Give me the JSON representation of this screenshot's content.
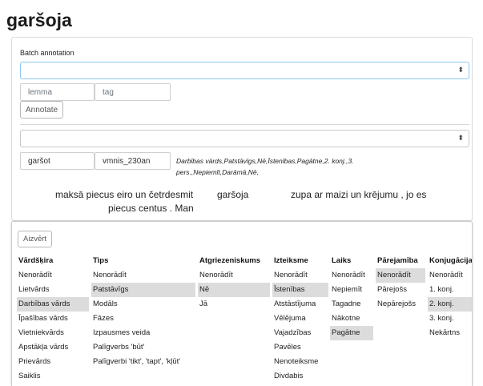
{
  "page_title": "garšoja",
  "batch": {
    "label": "Batch annotation",
    "select_caret": "⬍",
    "lemma_placeholder": "lemma",
    "tag_placeholder": "tag",
    "annotate_label": "Annotate"
  },
  "token": {
    "select_caret": "⬍",
    "lemma_value": "garšot",
    "tag_value": "vmnis_230an",
    "description": "Darbības vārds,Patstāvīgs,Nē,Īstenības,Pagātne,2. konj.,3. pers.,Nepiemīt,Darāmā,Nē,"
  },
  "sentence": {
    "line1": [
      "maksā piecus eiro un četrdesmit",
      "garšoja",
      "zupa ar maizi un krējumu , jo es"
    ],
    "line2": [
      "piecus centus . Man"
    ]
  },
  "panel": {
    "close_label": "Aizvērt",
    "columns": [
      {
        "header": "Vārdšķira",
        "items": [
          {
            "label": "Nenorādīt",
            "selected": false
          },
          {
            "label": "Lietvārds",
            "selected": false
          },
          {
            "label": "Darbības vārds",
            "selected": true
          },
          {
            "label": "Īpašības vārds",
            "selected": false
          },
          {
            "label": "Vietniekvārds",
            "selected": false
          },
          {
            "label": "Apstākļa vārds",
            "selected": false
          },
          {
            "label": "Prievārds",
            "selected": false
          },
          {
            "label": "Saiklis",
            "selected": false
          }
        ]
      },
      {
        "header": "Tips",
        "items": [
          {
            "label": "Nenorādīt",
            "selected": false
          },
          {
            "label": "Patstāvīgs",
            "selected": true
          },
          {
            "label": "Modāls",
            "selected": false
          },
          {
            "label": "Fāzes",
            "selected": false
          },
          {
            "label": "Izpausmes veida",
            "selected": false
          },
          {
            "label": "Palīgverbs 'būt'",
            "selected": false
          },
          {
            "label": "Palīgverbi 'tikt', 'tapt', 'kļūt'",
            "selected": false
          }
        ]
      },
      {
        "header": "Atgriezeniskums",
        "items": [
          {
            "label": "Nenorādīt",
            "selected": false
          },
          {
            "label": "Nē",
            "selected": true
          },
          {
            "label": "Jā",
            "selected": false
          }
        ]
      },
      {
        "header": "Izteiksme",
        "items": [
          {
            "label": "Nenorādīt",
            "selected": false
          },
          {
            "label": "Īstenības",
            "selected": true
          },
          {
            "label": "Atstāstījuma",
            "selected": false
          },
          {
            "label": "Vēlējuma",
            "selected": false
          },
          {
            "label": "Vajadzības",
            "selected": false
          },
          {
            "label": "Pavēles",
            "selected": false
          },
          {
            "label": "Nenoteiksme",
            "selected": false
          },
          {
            "label": "Divdabis",
            "selected": false
          }
        ]
      },
      {
        "header": "Laiks",
        "items": [
          {
            "label": "Nenorādīt",
            "selected": false
          },
          {
            "label": "Nepiemīt",
            "selected": false
          },
          {
            "label": "Tagadne",
            "selected": false
          },
          {
            "label": "Nākotne",
            "selected": false
          },
          {
            "label": "Pagātne",
            "selected": true
          }
        ]
      },
      {
        "header": "Pārejamība",
        "items": [
          {
            "label": "Nenorādīt",
            "selected": true
          },
          {
            "label": "Pārejošs",
            "selected": false
          },
          {
            "label": "Nepārejošs",
            "selected": false
          }
        ]
      },
      {
        "header": "Konjugācija",
        "items": [
          {
            "label": "Nenorādīt",
            "selected": false
          },
          {
            "label": "1. konj.",
            "selected": false
          },
          {
            "label": "2. konj.",
            "selected": true
          },
          {
            "label": "3. konj.",
            "selected": false
          },
          {
            "label": "Nekārtns",
            "selected": false
          }
        ]
      }
    ]
  }
}
